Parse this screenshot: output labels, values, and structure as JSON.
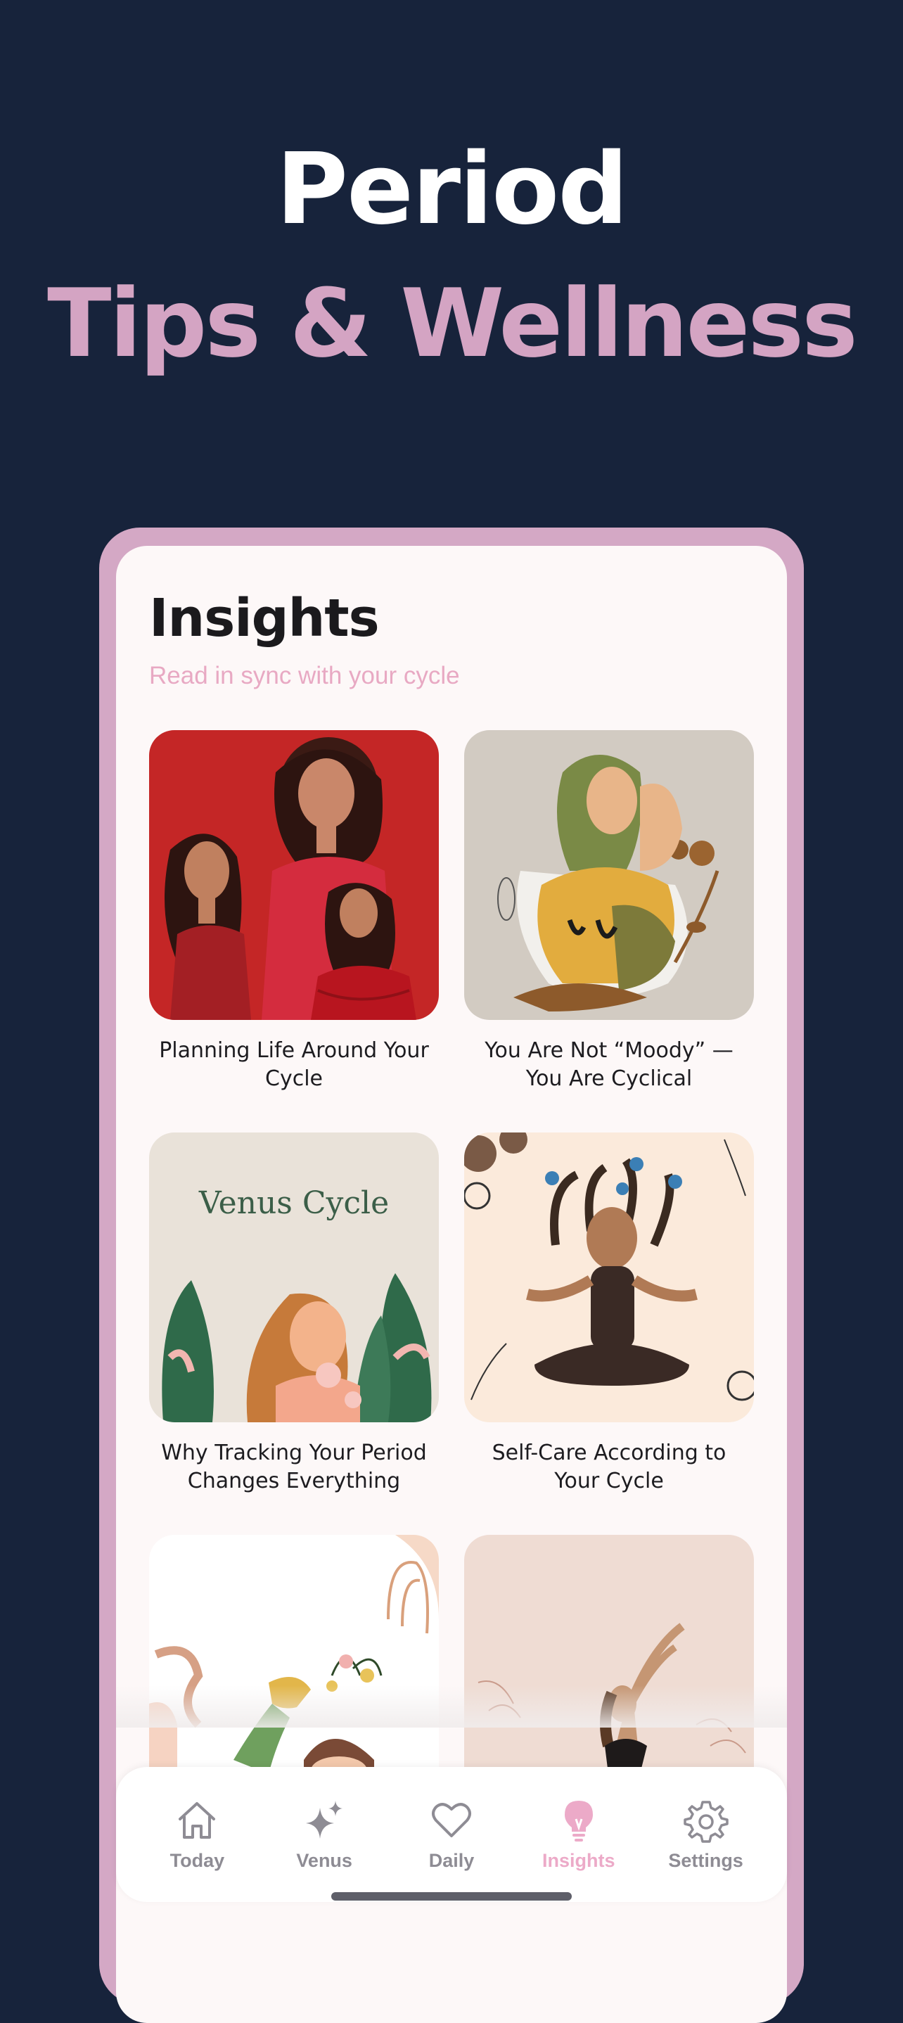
{
  "hero": {
    "line1": "Period",
    "line2": "Tips & Wellness"
  },
  "screen": {
    "title": "Insights",
    "subtitle": "Read in sync with your cycle"
  },
  "articles": [
    {
      "title": "Planning Life Around Your Cycle"
    },
    {
      "title": "You Are Not “Moody” — You Are Cyclical"
    },
    {
      "title": "Why Tracking Your Period Changes Everything",
      "image_text": "Venus Cycle"
    },
    {
      "title": "Self-Care According to Your Cycle"
    },
    {
      "title": ""
    },
    {
      "title": ""
    }
  ],
  "tabbar": {
    "items": [
      {
        "label": "Today",
        "icon": "home-icon",
        "active": false
      },
      {
        "label": "Venus",
        "icon": "sparkles-icon",
        "active": false
      },
      {
        "label": "Daily",
        "icon": "heart-icon",
        "active": false
      },
      {
        "label": "Insights",
        "icon": "lightbulb-icon",
        "active": true
      },
      {
        "label": "Settings",
        "icon": "gear-icon",
        "active": false
      }
    ]
  },
  "colors": {
    "background": "#17233b",
    "accent_pink": "#d4a4c3",
    "subtitle_pink": "#e8a9c3",
    "active_tab": "#ecaac8",
    "inactive_tab": "#8e8c94"
  }
}
